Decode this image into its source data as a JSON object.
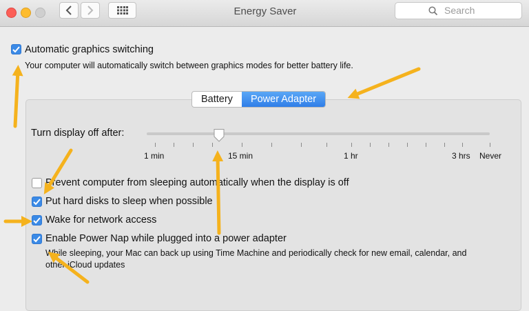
{
  "window": {
    "title": "Energy Saver"
  },
  "search": {
    "placeholder": "Search"
  },
  "auto_graphics": {
    "label": "Automatic graphics switching",
    "checked": true,
    "description": "Your computer will automatically switch between graphics modes for better battery life."
  },
  "tabs": [
    {
      "label": "Battery",
      "selected": false
    },
    {
      "label": "Power Adapter",
      "selected": true
    }
  ],
  "slider": {
    "label": "Turn display off after:",
    "ticks": [
      "1 min",
      "15 min",
      "1 hr",
      "3 hrs",
      "Never"
    ],
    "value": "10 min"
  },
  "options": [
    {
      "label": "Prevent computer from sleeping automatically when the display is off",
      "checked": false
    },
    {
      "label": "Put hard disks to sleep when possible",
      "checked": true
    },
    {
      "label": "Wake for network access",
      "checked": true
    },
    {
      "label": "Enable Power Nap while plugged into a power adapter",
      "checked": true
    }
  ],
  "power_nap_description": "While sleeping, your Mac can back up using Time Machine and periodically check for new email, calendar, and other iCloud updates",
  "colors": {
    "accent": "#3b8ae6",
    "annotation_arrow": "#f5b21d",
    "close": "#fc5f57",
    "minimize": "#fdbc2e",
    "zoom": "#cfcfcf"
  },
  "icons": [
    "back-icon",
    "forward-icon",
    "grid-icon",
    "search-icon",
    "checkmark-icon",
    "arrow-annotation"
  ]
}
